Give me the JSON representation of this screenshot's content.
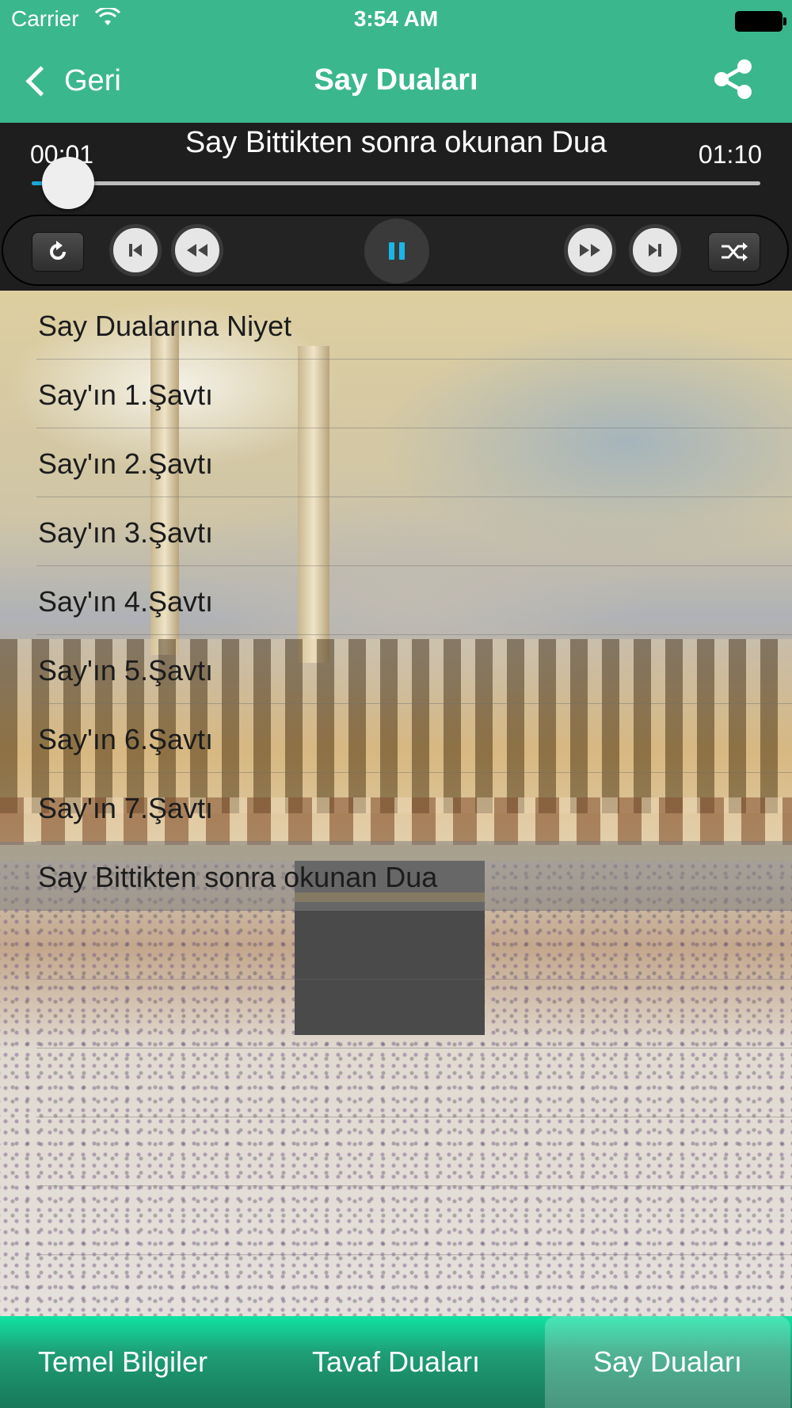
{
  "status_bar": {
    "carrier": "Carrier",
    "time": "3:54 AM"
  },
  "nav": {
    "back_label": "Geri",
    "title": "Say Duaları",
    "share_icon": "share-icon"
  },
  "player": {
    "track_title": "Say Bittikten sonra okunan Dua",
    "elapsed": "00:01",
    "duration": "01:10",
    "progress": 0.05,
    "progress_color": "#1aa7d8",
    "controls": [
      "repeat-icon",
      "skip-previous-icon",
      "rewind-icon",
      "pause-icon",
      "fast-forward-icon",
      "skip-next-icon",
      "shuffle-icon"
    ],
    "accent_color": "#19b6e6"
  },
  "list": {
    "items": [
      {
        "label": "Say Dualarına Niyet"
      },
      {
        "label": "Say'ın 1.Şavtı"
      },
      {
        "label": "Say'ın 2.Şavtı"
      },
      {
        "label": "Say'ın 3.Şavtı"
      },
      {
        "label": "Say'ın 4.Şavtı"
      },
      {
        "label": "Say'ın 5.Şavtı"
      },
      {
        "label": "Say'ın 6.Şavtı"
      },
      {
        "label": "Say'ın 7.Şavtı"
      },
      {
        "label": "Say Bittikten sonra okunan Dua",
        "active": true
      }
    ]
  },
  "tabs": [
    {
      "label": "Temel Bilgiler"
    },
    {
      "label": "Tavaf Duaları"
    },
    {
      "label": "Say Duaları",
      "selected": true
    }
  ],
  "colors": {
    "header": "#3bb78d",
    "player_bg": "#1e1e1e",
    "tabbar": "#1f9e75"
  }
}
